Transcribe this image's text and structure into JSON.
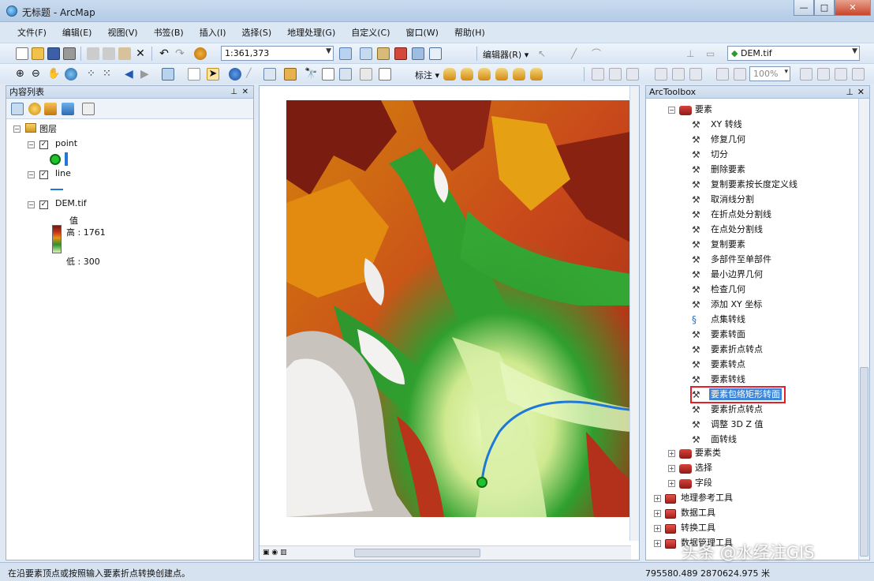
{
  "window": {
    "title": "无标题 - ArcMap"
  },
  "menu": [
    "文件(F)",
    "编辑(E)",
    "视图(V)",
    "书签(B)",
    "插入(I)",
    "选择(S)",
    "地理处理(G)",
    "自定义(C)",
    "窗口(W)",
    "帮助(H)"
  ],
  "toolbar": {
    "scale": "1:361,373",
    "editor_label": "编辑器(R) ▾",
    "layer_combo": "DEM.tif",
    "georef_label": "标注 ▾",
    "zoom_combo": "100%"
  },
  "toc": {
    "title": "内容列表",
    "root_label": "图层",
    "layers": [
      {
        "name": "point",
        "checked": true
      },
      {
        "name": "line",
        "checked": true
      },
      {
        "name": "DEM.tif",
        "checked": true
      }
    ],
    "dem_legend": {
      "label": "值",
      "high": "高 : 1761",
      "low": "低 : 300"
    }
  },
  "toolbox": {
    "title": "ArcToolbox",
    "toolset": "要素",
    "tools": [
      "XY 转线",
      "修复几何",
      "切分",
      "删除要素",
      "复制要素按长度定义线",
      "取消线分割",
      "在折点处分割线",
      "在点处分割线",
      "复制要素",
      "多部件至单部件",
      "最小边界几何",
      "检查几何",
      "添加 XY 坐标",
      "点集转线",
      "要素转面",
      "要素折点转点",
      "要素转点",
      "要素转线",
      "要素包络矩形转面",
      "要素折点转点",
      "调整 3D Z 值",
      "面转线"
    ],
    "selected_tool": "要素折点转点",
    "sub_toolsets": [
      "要素类",
      "选择",
      "字段"
    ],
    "toolboxes": [
      "地理参考工具",
      "数据工具",
      "转换工具",
      "数据管理工具"
    ]
  },
  "status": {
    "message": "在沿要素顶点或按照输入要素折点转换创建点。",
    "coordinates": "795580.489  2870624.975 米"
  },
  "watermark": "头条 @水经注GIS",
  "colors": {
    "selection_red": "#e3202a",
    "selected_bg": "#3d86d9",
    "line_blue": "#1e78d8",
    "point_green": "#22c22e"
  }
}
